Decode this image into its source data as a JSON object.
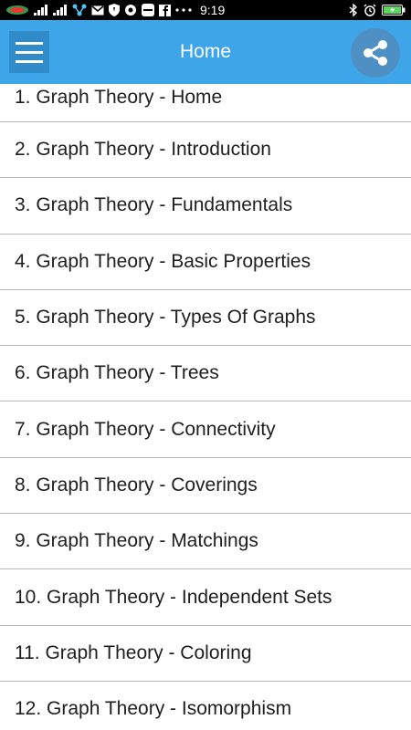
{
  "status_bar": {
    "time": "9:19",
    "icons": [
      "carrier-logo-icon",
      "signal-icon",
      "signal-icon",
      "network-icon",
      "gmail-icon",
      "shield-icon",
      "settings-icon",
      "zalo-icon",
      "facebook-icon",
      "more-icon",
      "bluetooth-icon",
      "alarm-icon",
      "battery-icon"
    ]
  },
  "app_bar": {
    "title": "Home",
    "color": "#3ea6e8"
  },
  "list": {
    "items": [
      {
        "label": "1. Graph Theory - Home"
      },
      {
        "label": "2. Graph Theory - Introduction"
      },
      {
        "label": "3. Graph Theory - Fundamentals"
      },
      {
        "label": "4. Graph Theory - Basic Properties"
      },
      {
        "label": "5. Graph Theory - Types Of Graphs"
      },
      {
        "label": "6. Graph Theory - Trees"
      },
      {
        "label": "7. Graph Theory - Connectivity"
      },
      {
        "label": "8. Graph Theory - Coverings"
      },
      {
        "label": "9. Graph Theory - Matchings"
      },
      {
        "label": "10. Graph Theory - Independent Sets"
      },
      {
        "label": "11. Graph Theory - Coloring"
      },
      {
        "label": "12. Graph Theory - Isomorphism"
      }
    ]
  }
}
